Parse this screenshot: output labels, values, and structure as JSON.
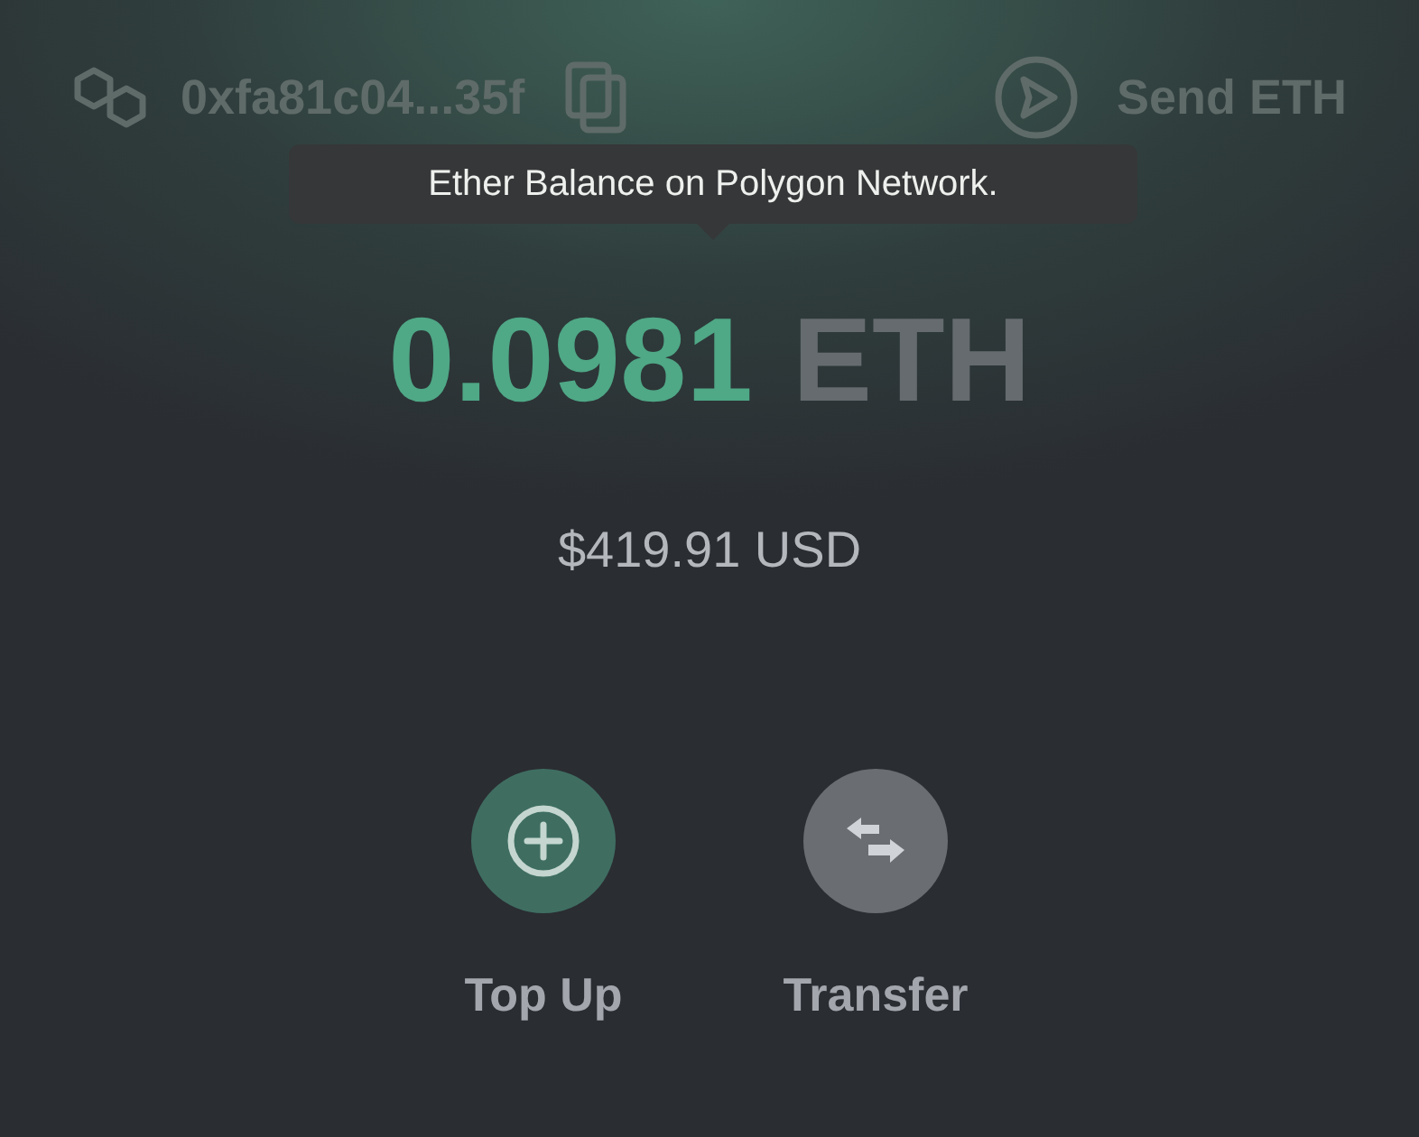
{
  "header": {
    "address": "0xfa81c04...35f",
    "send_label": "Send ETH"
  },
  "tooltip": {
    "text": "Ether Balance on Polygon Network."
  },
  "balance": {
    "amount": "0.0981",
    "unit": "ETH",
    "fiat": "$419.91 USD"
  },
  "actions": [
    {
      "kind": "topup",
      "label": "Top Up"
    },
    {
      "kind": "transfer",
      "label": "Transfer"
    }
  ]
}
